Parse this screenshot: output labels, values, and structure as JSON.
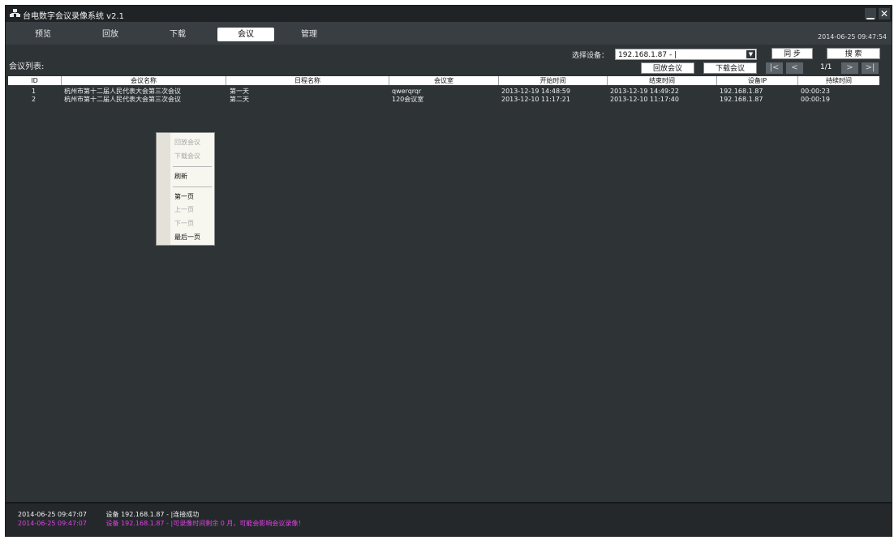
{
  "window": {
    "title": "台电数字会议录像系统 v2.1",
    "minimize_label": "▁",
    "close_label": "✕"
  },
  "tabs": [
    {
      "label": "预览",
      "active": false
    },
    {
      "label": "回放",
      "active": false
    },
    {
      "label": "下载",
      "active": false
    },
    {
      "label": "会议",
      "active": true
    },
    {
      "label": "管理",
      "active": false
    }
  ],
  "clock": "2014-06-25 09:47:54",
  "toolbar": {
    "list_label": "会议列表:",
    "device_label": "选择设备：",
    "device_value": "192.168.1.87 - |",
    "sync_label": "同 步",
    "search_label": "搜 索",
    "playback_label": "回放会议",
    "download_label": "下载会议",
    "first_page": "|<",
    "prev_page": "<",
    "page_indicator": "1/1",
    "next_page": ">",
    "last_page": ">|"
  },
  "table": {
    "columns": [
      "ID",
      "会议名称",
      "日程名称",
      "会议室",
      "开始时间",
      "结束时间",
      "设备IP",
      "持续时间"
    ],
    "rows": [
      [
        "1",
        "杭州市第十二届人民代表大会第三次会议",
        "第一天",
        "qwerqrqr",
        "2013-12-19 14:48:59",
        "2013-12-19 14:49:22",
        "192.168.1.87",
        "00:00:23"
      ],
      [
        "2",
        "杭州市第十二届人民代表大会第三次会议",
        "第二天",
        "120会议室",
        "2013-12-10 11:17:21",
        "2013-12-10 11:17:40",
        "192.168.1.87",
        "00:00:19"
      ]
    ]
  },
  "context_menu": {
    "items": [
      {
        "label": "回放会议",
        "enabled": false
      },
      {
        "label": "下载会议",
        "enabled": false
      },
      {
        "label": "刷新",
        "enabled": true
      },
      {
        "label": "第一页",
        "enabled": true
      },
      {
        "label": "上一页",
        "enabled": false
      },
      {
        "label": "下一页",
        "enabled": false
      },
      {
        "label": "最后一页",
        "enabled": true
      }
    ]
  },
  "log": [
    {
      "time": "2014-06-25 09:47:07",
      "message": "设备 192.168.1.87 - |连接成功",
      "color": "#f2f2f2"
    },
    {
      "time": "2014-06-25 09:47:07",
      "message": "设备 192.168.1.87 - |可录像时间剩余 0 月，可能会影响会议录像！",
      "color": "#e040e6"
    }
  ]
}
